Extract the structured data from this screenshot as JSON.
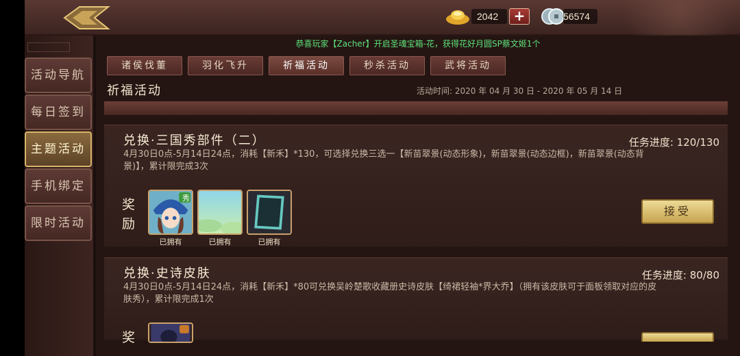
{
  "currency": {
    "gold": "2042",
    "plus": "+",
    "coins": "56574"
  },
  "marquee": "恭喜玩家【Zacher】开启圣魂宝箱-花，获得花好月圆SP蔡文姬1个",
  "sidebar": [
    {
      "label": "活动导航",
      "active": false
    },
    {
      "label": "每日签到",
      "active": false
    },
    {
      "label": "主题活动",
      "active": true
    },
    {
      "label": "手机绑定",
      "active": false
    },
    {
      "label": "限时活动",
      "active": false
    }
  ],
  "tabs": [
    {
      "label": "诸侯伐董"
    },
    {
      "label": "羽化飞升"
    },
    {
      "label": "祈福活动"
    },
    {
      "label": "秒杀活动"
    },
    {
      "label": "武将活动"
    }
  ],
  "section": {
    "title": "祈福活动",
    "time": "活动时间: 2020 年 04 月 30 日  - 2020 年 05 月 14 日"
  },
  "cards": [
    {
      "title": "兑换·三国秀部件（二）",
      "progress_label": "任务进度:",
      "progress_value": "120/130",
      "desc": "4月30日0点-5月14日24点，消耗【新禾】*130，可选择兑换三选一【新苗翠景(动态形象)，新苗翠景(动态边框)，新苗翠景(动态背景)】，累计限完成3次",
      "reward_label": "奖励",
      "rewards": [
        {
          "owned": "已拥有",
          "badge": "秀"
        },
        {
          "owned": "已拥有"
        },
        {
          "owned": "已拥有"
        }
      ],
      "button": "接受"
    },
    {
      "title": "兑换·史诗皮肤",
      "progress_label": "任务进度:",
      "progress_value": "80/80",
      "desc": "4月30日0点-5月14日24点，消耗【新禾】*80可兑换吴岭楚歌收藏册史诗皮肤【绮裙轻袖*界大乔】（拥有该皮肤可于面板领取对应的皮肤秀），累计限完成1次",
      "reward_label": "奖"
    }
  ]
}
